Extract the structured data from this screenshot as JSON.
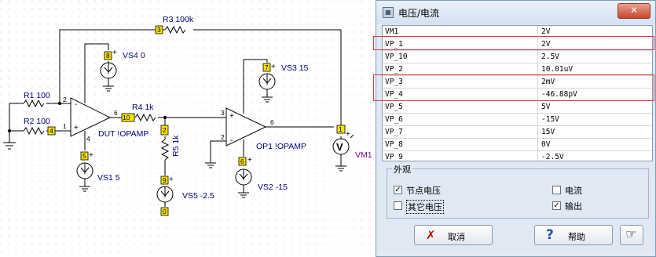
{
  "schematic": {
    "components": {
      "r3": "R3 100k",
      "r1": "R1 100",
      "r2": "R2 100",
      "r4": "R4 1k",
      "r5": "R5 1k",
      "vs4": "VS4 0",
      "vs1": "VS1 5",
      "vs5": "VS5 -2.5",
      "vs2": "VS2 -15",
      "vs3": "VS3 15",
      "vm1": "VM1",
      "dut": "DUT !OPAMP",
      "op1": "OP1 !OPAMP",
      "vm1_symbol": "V"
    },
    "nodes": {
      "n3": "3",
      "n8": "8",
      "n4": "4",
      "n10": "10",
      "n2": "2",
      "n9": "9",
      "n0": "0",
      "n5": "5",
      "n7": "7",
      "n6": "6",
      "n1": "1"
    },
    "pins": {
      "dut_p2": "2",
      "dut_p1": "1",
      "dut_p6": "6",
      "dut_p4": "4",
      "op1_p3": "3",
      "op1_p2": "2",
      "op1_p6": "6",
      "plus": "+",
      "minus": "-"
    }
  },
  "dialog": {
    "title": "电压/电流",
    "close_label": "✕",
    "rows": [
      {
        "name": "VM1",
        "value": "2V"
      },
      {
        "name": "VP_1",
        "value": "2V"
      },
      {
        "name": "VP_10",
        "value": "2.5V"
      },
      {
        "name": "VP_2",
        "value": "10.01uV"
      },
      {
        "name": "VP_3",
        "value": "2mV"
      },
      {
        "name": "VP_4",
        "value": "-46.88pV"
      },
      {
        "name": "VP_5",
        "value": "5V"
      },
      {
        "name": "VP_6",
        "value": "-15V"
      },
      {
        "name": "VP_7",
        "value": "15V"
      },
      {
        "name": "VP_8",
        "value": "0V"
      },
      {
        "name": "VP_9",
        "value": "-2.5V"
      }
    ],
    "group_title": "外观",
    "options": {
      "node_voltage": "节点电压",
      "current": "电流",
      "other_voltage": "其它电压",
      "output": "输出"
    },
    "checked": {
      "node_voltage": "✓",
      "current": "",
      "other_voltage": "",
      "output": "✓"
    },
    "buttons": {
      "cancel": "取消",
      "help": "帮助"
    },
    "icons": {
      "cancel": "✗",
      "help": "?",
      "pointer": "☞"
    }
  }
}
